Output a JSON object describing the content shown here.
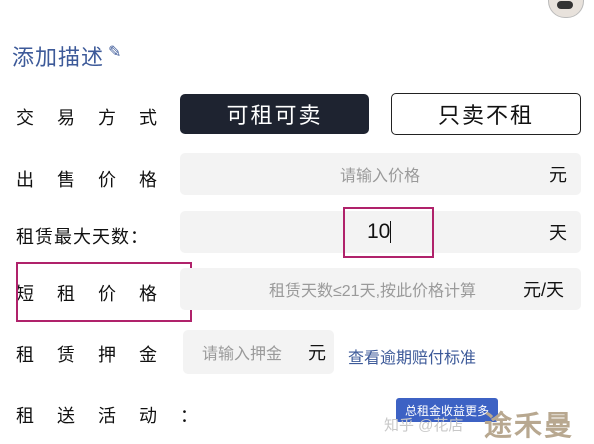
{
  "header": {
    "title": "添加描述",
    "edit_icon": "pencil-icon"
  },
  "trade_mode": {
    "label": "交 易 方 式 ：",
    "options": [
      "可租可卖",
      "只卖不租"
    ],
    "selected": "可租可卖"
  },
  "sale_price": {
    "label": "出 售 价 格 ：",
    "placeholder": "请输入价格",
    "unit": "元"
  },
  "max_rent_days": {
    "label": "租赁最大天数：",
    "value": "10",
    "unit": "天"
  },
  "short_rent_price": {
    "label": "短 租 价 格 ：",
    "placeholder": "租赁天数≤21天,按此价格计算",
    "unit": "元/天"
  },
  "deposit": {
    "label": "租 赁 押 金 ：",
    "placeholder": "请输入押金",
    "unit": "元",
    "link": "查看逾期赔付标准"
  },
  "rent_activity": {
    "label": "租 送 活 动 ：",
    "badge": "总租金收益更多"
  },
  "watermarks": {
    "zhihu": "知乎 @花店",
    "brand": "途禾曼"
  },
  "colors": {
    "accent": "#3d5a99",
    "dark_button": "#1e2330",
    "highlight_box": "#b0226b",
    "field_bg": "#f3f3f3"
  }
}
